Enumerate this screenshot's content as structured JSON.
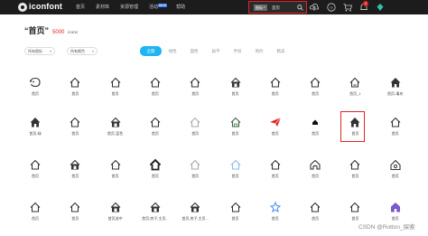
{
  "topbar": {
    "logo_text": "iconfont",
    "nav": [
      "首页",
      "素材库",
      "资源管理",
      "活动",
      "帮助"
    ],
    "nav_badge": "NEW",
    "search": {
      "type_label": "图标",
      "query": "首页"
    },
    "notification_count": "1"
  },
  "header": {
    "title": "“首页”",
    "count": "5000",
    "unit": "icons"
  },
  "filters": [
    "所有图标",
    "所有颜色"
  ],
  "tabs": [
    "全部",
    "线性",
    "面性",
    "扁平",
    "手绘",
    "简约",
    "精美"
  ],
  "icons": [
    {
      "shape": "face",
      "label": "首页"
    },
    {
      "shape": "house",
      "label": "首页"
    },
    {
      "shape": "house",
      "label": "首页"
    },
    {
      "shape": "house",
      "label": "首页"
    },
    {
      "shape": "house",
      "label": "首页"
    },
    {
      "shape": "house-dark",
      "label": "首页"
    },
    {
      "shape": "house",
      "label": "首页"
    },
    {
      "shape": "house",
      "label": "首页"
    },
    {
      "shape": "house-2",
      "label": "首页_1"
    },
    {
      "shape": "house-filled",
      "label": "首页-填充"
    },
    {
      "shape": "house-filled",
      "label": "首页-绿"
    },
    {
      "shape": "house",
      "label": "首页"
    },
    {
      "shape": "house-dark",
      "label": "首页-蓝色"
    },
    {
      "shape": "house",
      "label": "首页"
    },
    {
      "shape": "house-light",
      "label": "首页"
    },
    {
      "shape": "house-green",
      "label": "首页"
    },
    {
      "shape": "paper-plane",
      "label": "首页"
    },
    {
      "shape": "house-small",
      "label": "首页"
    },
    {
      "shape": "house-filled-selected",
      "label": "首页"
    },
    {
      "shape": "house",
      "label": "首页"
    },
    {
      "shape": "house",
      "label": "首页"
    },
    {
      "shape": "house-dark",
      "label": "首页"
    },
    {
      "shape": "house",
      "label": "首页"
    },
    {
      "shape": "house-heavy",
      "label": "首页"
    },
    {
      "shape": "house-light",
      "label": "首页"
    },
    {
      "shape": "house-blue-light",
      "label": "首页"
    },
    {
      "shape": "house",
      "label": "首页"
    },
    {
      "shape": "house-arch",
      "label": "首页"
    },
    {
      "shape": "house",
      "label": "首页"
    },
    {
      "shape": "house-circle",
      "label": "首页"
    },
    {
      "shape": "house",
      "label": "首页"
    },
    {
      "shape": "house",
      "label": "首页"
    },
    {
      "shape": "house-dark",
      "label": "首页选中"
    },
    {
      "shape": "house-dark",
      "label": "首页,房子,主页..."
    },
    {
      "shape": "house-dark",
      "label": "首页,房子,主页..."
    },
    {
      "shape": "house",
      "label": "首页"
    },
    {
      "shape": "star-blue",
      "label": "首页"
    },
    {
      "shape": "house",
      "label": "首页"
    },
    {
      "shape": "house",
      "label": "首页"
    },
    {
      "shape": "house-purple",
      "label": "首页"
    }
  ],
  "watermark": "CSDN @Rotton_探索",
  "colors": {
    "topbar": "#1c1c1c",
    "accent": "#1fb5f0",
    "highlight": "#e02323",
    "count": "#e02323"
  }
}
